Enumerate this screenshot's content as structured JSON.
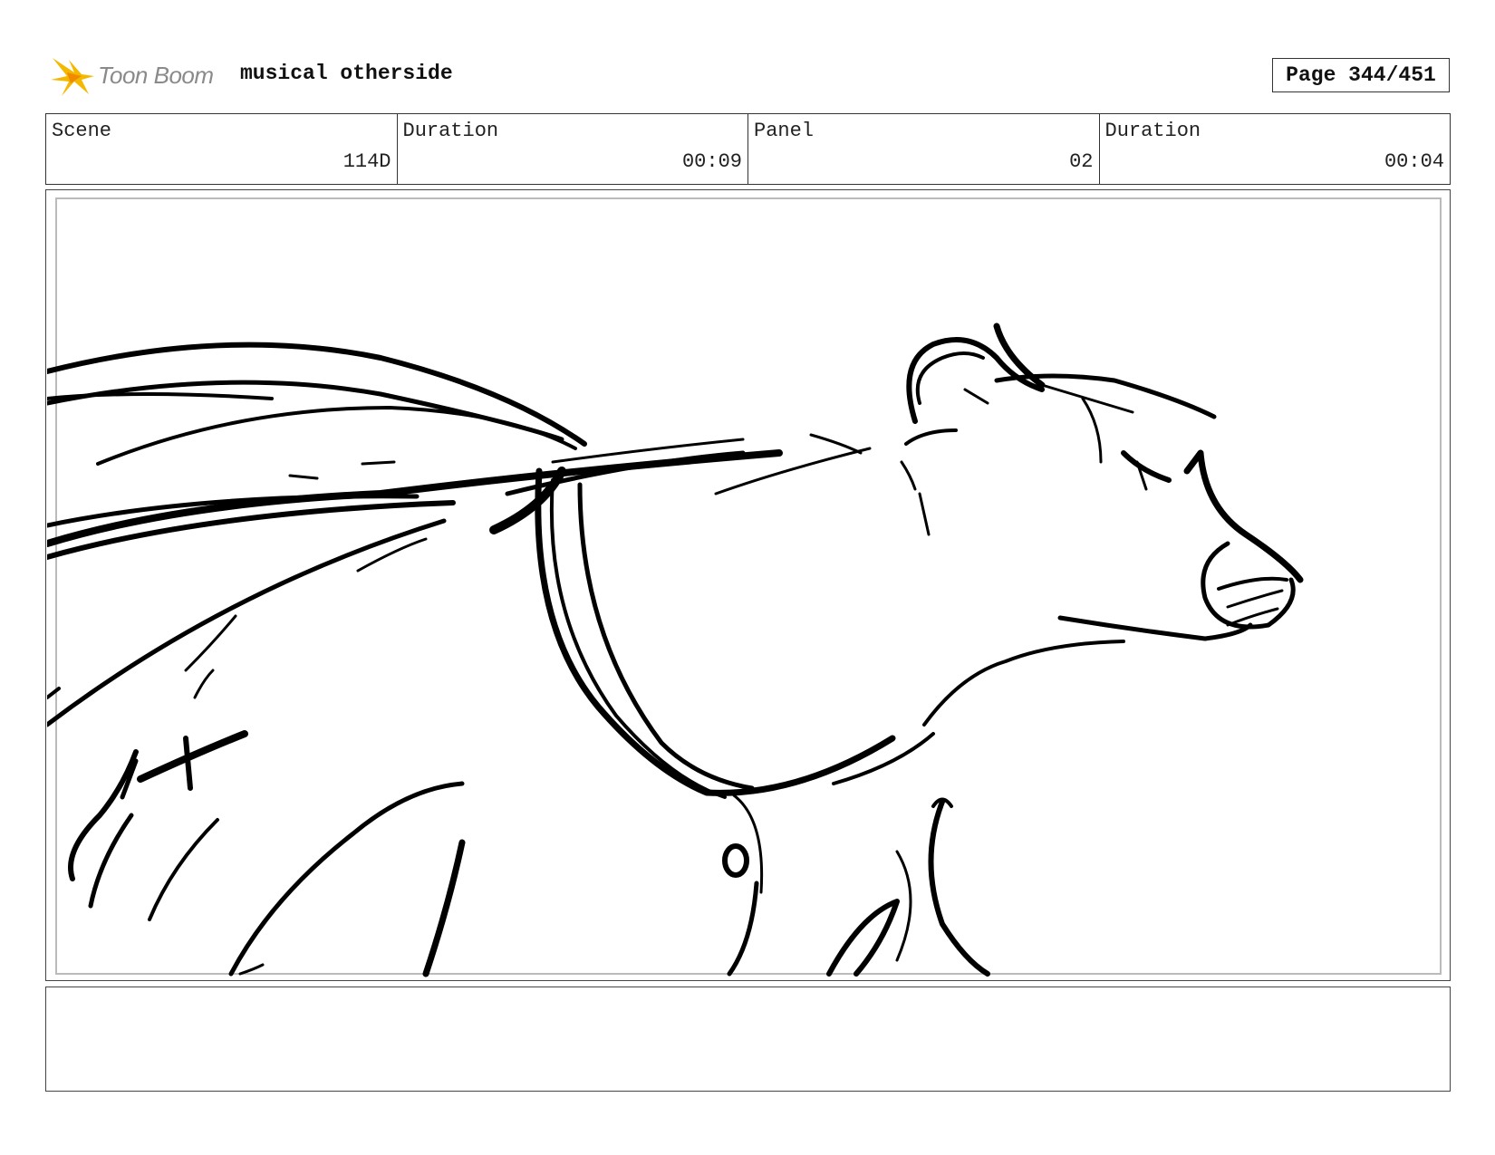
{
  "header": {
    "logo_text": "Toon Boom",
    "project_title": "musical otherside",
    "page_label": "Page 344/451"
  },
  "info": {
    "scene_label": "Scene",
    "scene_value": "114D",
    "scene_duration_label": "Duration",
    "scene_duration_value": "00:09",
    "panel_label": "Panel",
    "panel_value": "02",
    "panel_duration_label": "Duration",
    "panel_duration_value": "00:04"
  },
  "panel": {
    "image_alt": "Storyboard sketch"
  },
  "notes": {
    "text": ""
  },
  "colors": {
    "logo_yellow": "#f5b800",
    "logo_orange": "#f08a00",
    "ink": "#000000"
  }
}
